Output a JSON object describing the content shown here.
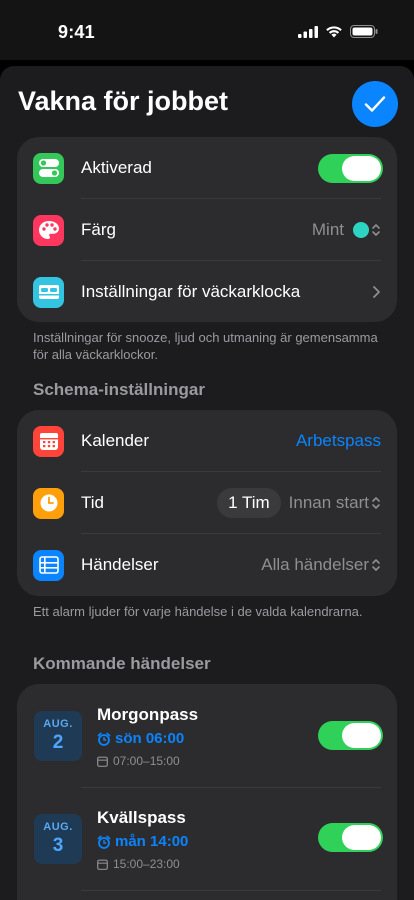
{
  "status": {
    "time": "9:41"
  },
  "header": {
    "title": "Vakna för jobbet"
  },
  "settings": {
    "enabled_label": "Aktiverad",
    "color_label": "Färg",
    "color_value": "Mint",
    "color_swatch": "#2dd4c4",
    "alarm_settings_label": "Inställningar för väckarklocka",
    "footnote": "Inställningar för snooze, ljud och utmaning är gemensamma för alla väckarklockor."
  },
  "schedule": {
    "header": "Schema-inställningar",
    "calendar_label": "Kalender",
    "calendar_value": "Arbetspass",
    "time_label": "Tid",
    "time_amount": "1 Tim",
    "time_relation": "Innan start",
    "events_label": "Händelser",
    "events_value": "Alla händelser",
    "footnote": "Ett alarm ljuder för varje händelse i de valda kalendrarna."
  },
  "upcoming": {
    "header": "Kommande händelser",
    "events": [
      {
        "month": "AUG.",
        "day": "2",
        "title": "Morgonpass",
        "alarm": "sön 06:00",
        "range": "07:00–15:00",
        "enabled": true
      },
      {
        "month": "AUG.",
        "day": "3",
        "title": "Kvällspass",
        "alarm": "mån 14:00",
        "range": "15:00–23:00",
        "enabled": true
      }
    ]
  },
  "colors": {
    "accent": "#0a84ff",
    "toggle_on": "#30d158"
  }
}
